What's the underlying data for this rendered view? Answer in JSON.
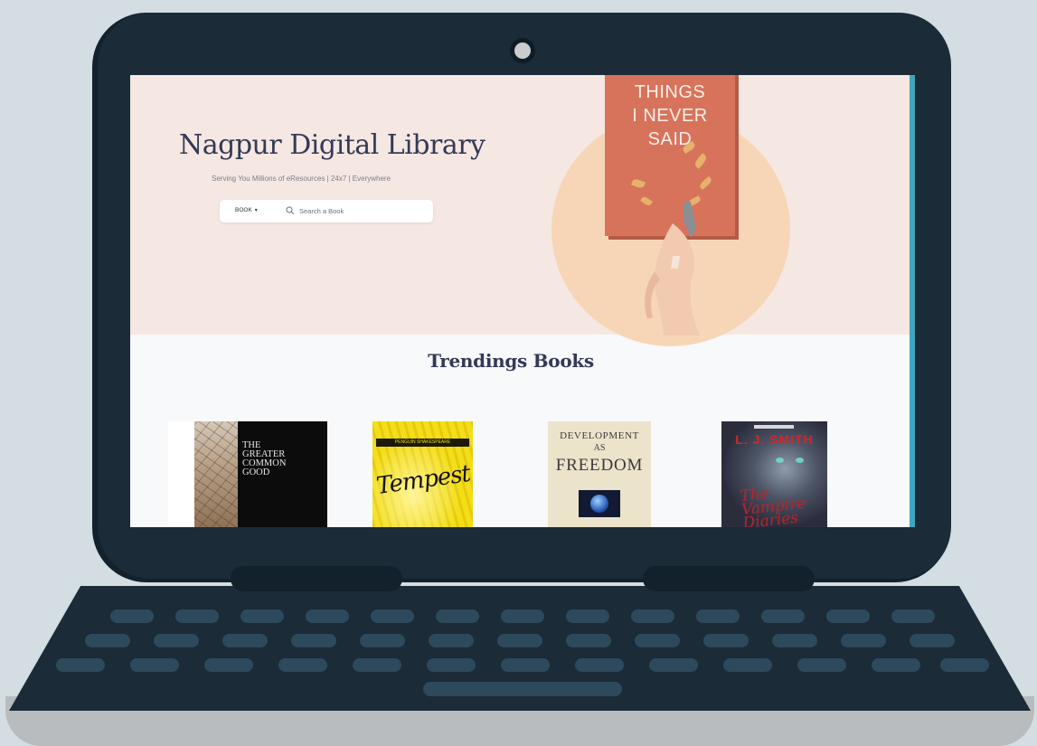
{
  "hero": {
    "title": "Nagpur Digital Library",
    "tagline": "Serving You Millions of eResources | 24x7 | Everywhere",
    "featured_book_title": "THINGS\nI NEVER\nSAID"
  },
  "search": {
    "type_label": "BOOK",
    "placeholder": "Search a Book"
  },
  "trending": {
    "title": "Trendings Books",
    "books": [
      {
        "cover_text": "THE GREATER COMMON GOOD"
      },
      {
        "publisher": "PENGUIN SHAKESPEARE",
        "cover_text": "Tempest"
      },
      {
        "cover_line1": "DEVELOPMENT",
        "cover_line2": "AS",
        "cover_line3": "FREEDOM"
      },
      {
        "author": "L. J. SMITH",
        "cover_text": "The Vampire Diaries"
      }
    ]
  },
  "colors": {
    "hero_bg": "#f5e7e1",
    "title": "#333a57",
    "laptop_frame": "#1b2b38",
    "background": "#d3dde2"
  }
}
